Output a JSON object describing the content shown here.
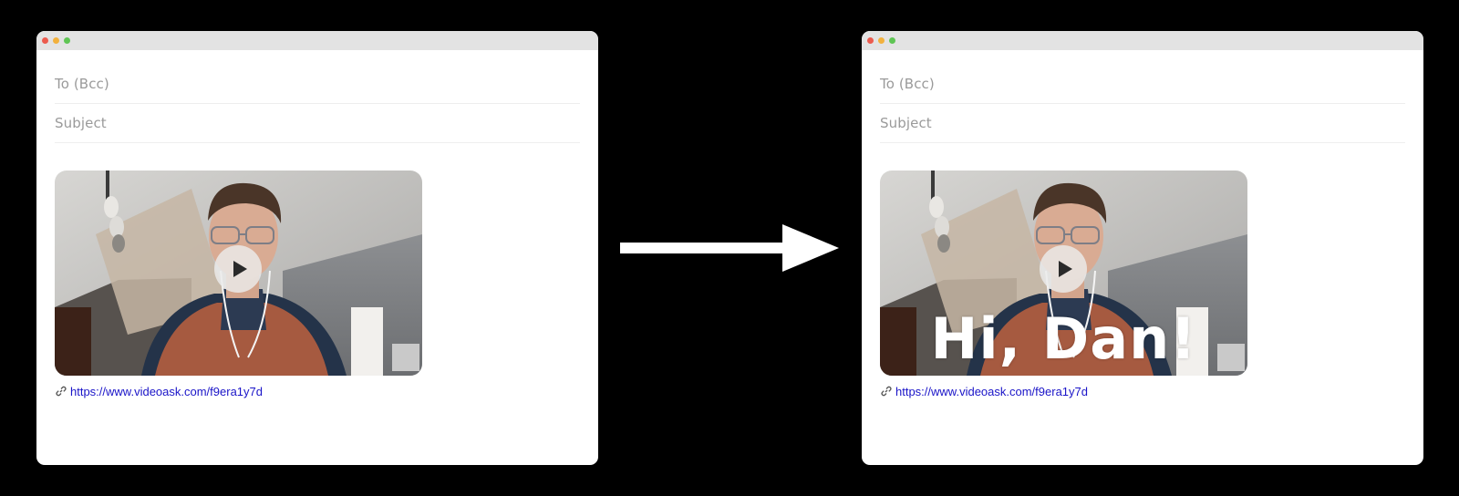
{
  "before": {
    "to_label": "To (Bcc)",
    "subject_label": "Subject",
    "video_overlay": "",
    "link": "https://www.videoask.com/f9era1y7d"
  },
  "after": {
    "to_label": "To (Bcc)",
    "subject_label": "Subject",
    "video_overlay": "Hi, Dan!",
    "link": "https://www.videoask.com/f9era1y7d"
  },
  "icons": {
    "link": "link-icon",
    "play": "play-icon",
    "arrow": "right-arrow-icon"
  },
  "colors": {
    "background": "#000000",
    "window": "#ffffff",
    "titlebar": "#e3e3e3",
    "link": "#1a14c8",
    "placeholder": "#9a9a9a",
    "traffic_red": "#ec5b4e",
    "traffic_yellow": "#f2b13d",
    "traffic_green": "#5fc554"
  }
}
